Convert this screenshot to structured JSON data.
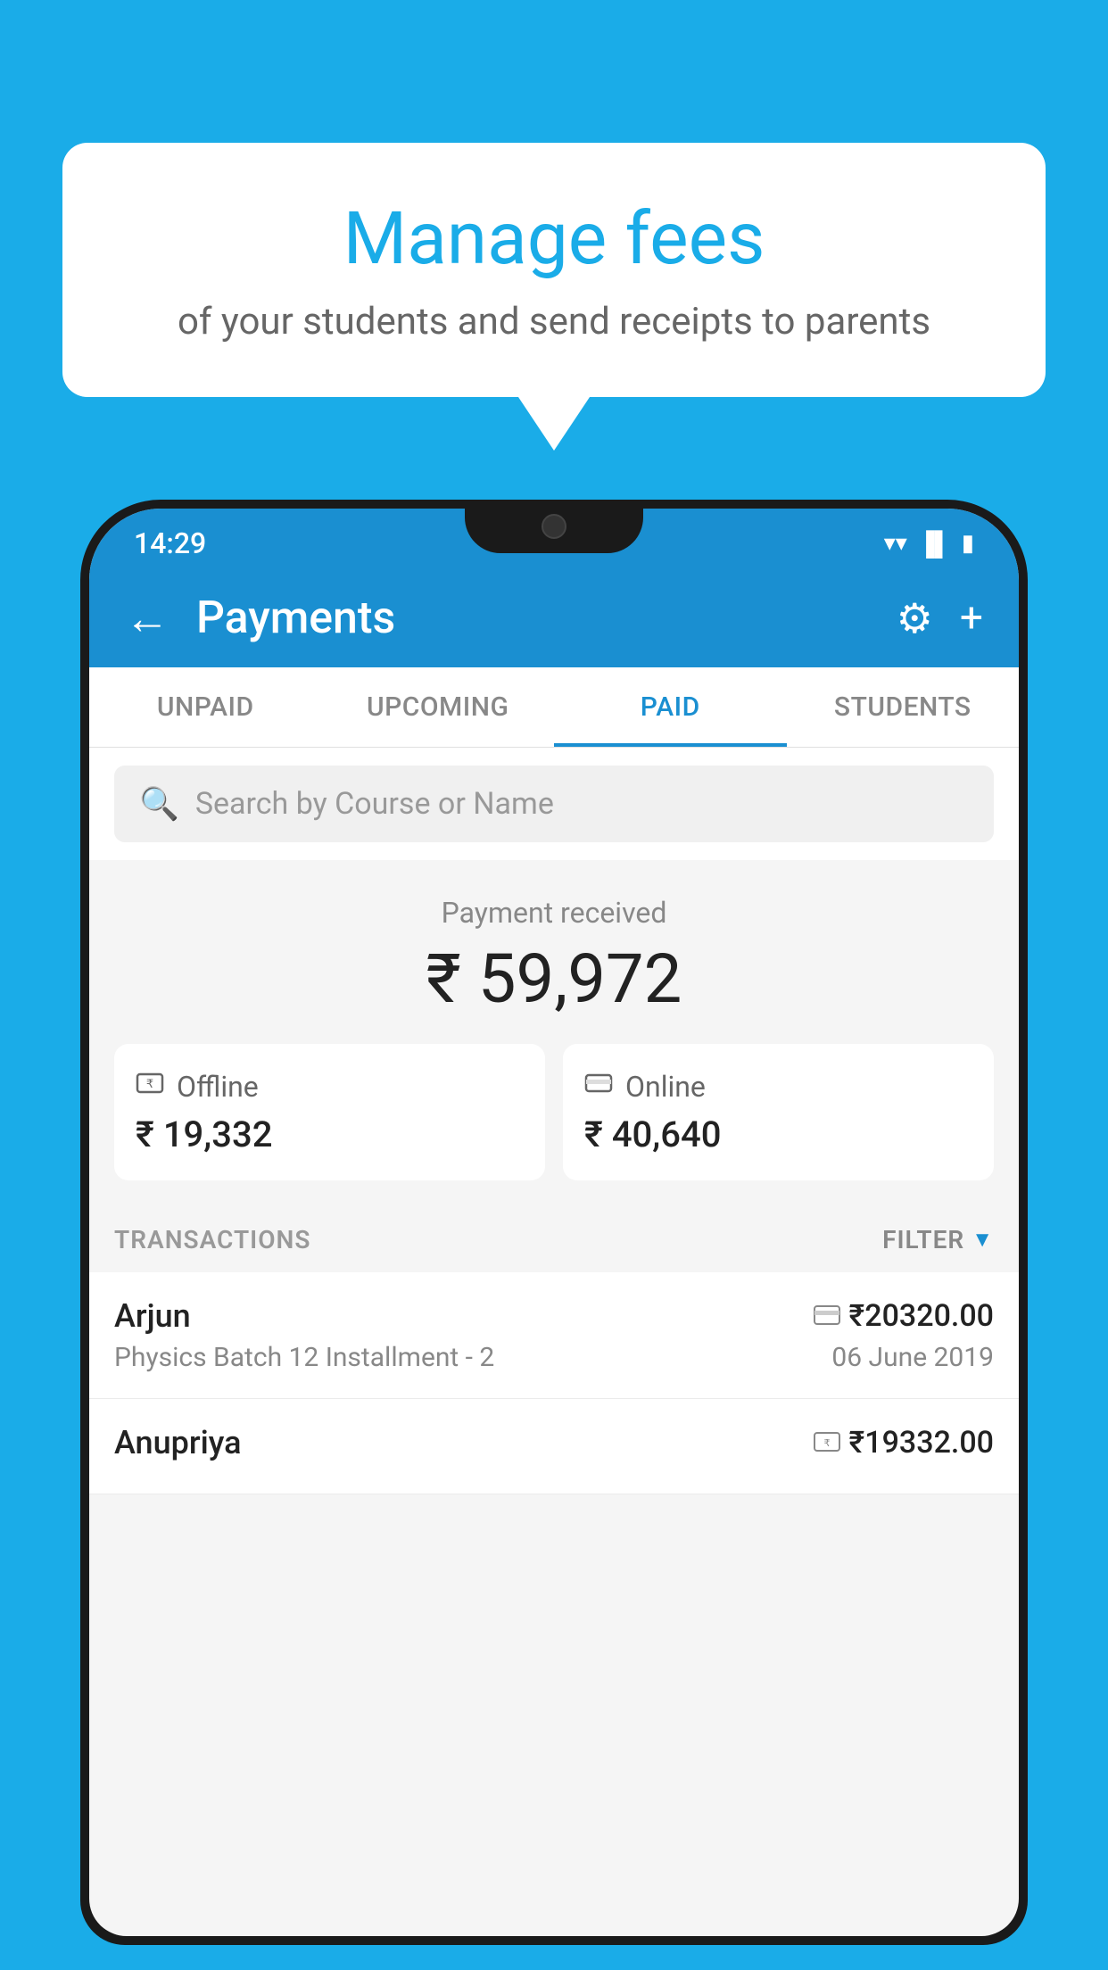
{
  "background_color": "#1aace8",
  "speech_bubble": {
    "heading": "Manage fees",
    "subtext": "of your students and send receipts to parents"
  },
  "status_bar": {
    "time": "14:29",
    "icons": [
      "wifi",
      "signal",
      "battery"
    ]
  },
  "app_bar": {
    "title": "Payments",
    "back_label": "←",
    "gear_label": "⚙",
    "plus_label": "+"
  },
  "tabs": [
    {
      "id": "unpaid",
      "label": "UNPAID",
      "active": false
    },
    {
      "id": "upcoming",
      "label": "UPCOMING",
      "active": false
    },
    {
      "id": "paid",
      "label": "PAID",
      "active": true
    },
    {
      "id": "students",
      "label": "STUDENTS",
      "active": false
    }
  ],
  "search": {
    "placeholder": "Search by Course or Name"
  },
  "payment_summary": {
    "label": "Payment received",
    "total": "₹ 59,972",
    "offline": {
      "type": "Offline",
      "amount": "₹ 19,332"
    },
    "online": {
      "type": "Online",
      "amount": "₹ 40,640"
    }
  },
  "transactions_section": {
    "label": "TRANSACTIONS",
    "filter_label": "FILTER"
  },
  "transactions": [
    {
      "name": "Arjun",
      "course": "Physics Batch 12 Installment - 2",
      "amount": "₹20320.00",
      "date": "06 June 2019",
      "payment_type": "online"
    },
    {
      "name": "Anupriya",
      "course": "",
      "amount": "₹19332.00",
      "date": "",
      "payment_type": "offline"
    }
  ]
}
